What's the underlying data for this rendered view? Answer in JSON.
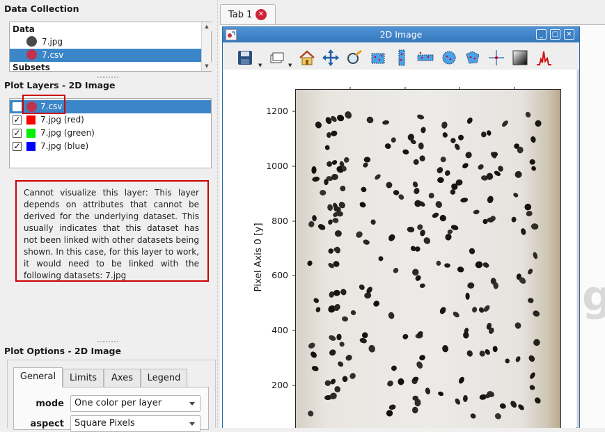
{
  "data_collection": {
    "title": "Data Collection",
    "group_data": "Data",
    "items": [
      {
        "label": "7.jpg",
        "color": "#4a4a4a"
      },
      {
        "label": "7.csv",
        "color": "#c0334d"
      }
    ],
    "group_subsets": "Subsets"
  },
  "plot_layers": {
    "title": "Plot Layers - 2D Image",
    "items": [
      {
        "label": "7.csv",
        "checked": false,
        "color": "#c0334d"
      },
      {
        "label": "7.jpg (red)",
        "checked": true,
        "color": "#ff0000"
      },
      {
        "label": "7.jpg (green)",
        "checked": true,
        "color": "#00ee00"
      },
      {
        "label": "7.jpg (blue)",
        "checked": true,
        "color": "#0000ff"
      }
    ],
    "check_mark": "✓",
    "warning": "Cannot visualize this layer:  This layer depends on attributes that cannot be derived for the underlying dataset. This usually indicates that this dataset has not been linked with other datasets being shown. In this case, for this layer to work, it would need to be linked with the following datasets: 7.jpg"
  },
  "plot_options": {
    "title": "Plot Options - 2D Image",
    "tabs": [
      "General",
      "Limits",
      "Axes",
      "Legend"
    ],
    "active_tab": "General",
    "mode_label": "mode",
    "mode_value": "One color per layer",
    "aspect_label": "aspect",
    "aspect_value": "Square Pixels"
  },
  "main_tab": {
    "label": "Tab 1",
    "close_glyph": "✕"
  },
  "subwindow": {
    "title": "2D Image",
    "buttons": {
      "minimize": "_",
      "maximize": "□",
      "close": "✕"
    }
  },
  "plot": {
    "ylabel": "Pixel Axis 0 [y]",
    "yticks": [
      "1200",
      "1000",
      "800",
      "600",
      "400",
      "200"
    ]
  },
  "watermark_glyph": "g",
  "colors": {
    "selection": "#3b86c8",
    "warning_border": "#cc0000",
    "titlebar": "#3a7fc4",
    "tab_close": "#d0213a"
  }
}
